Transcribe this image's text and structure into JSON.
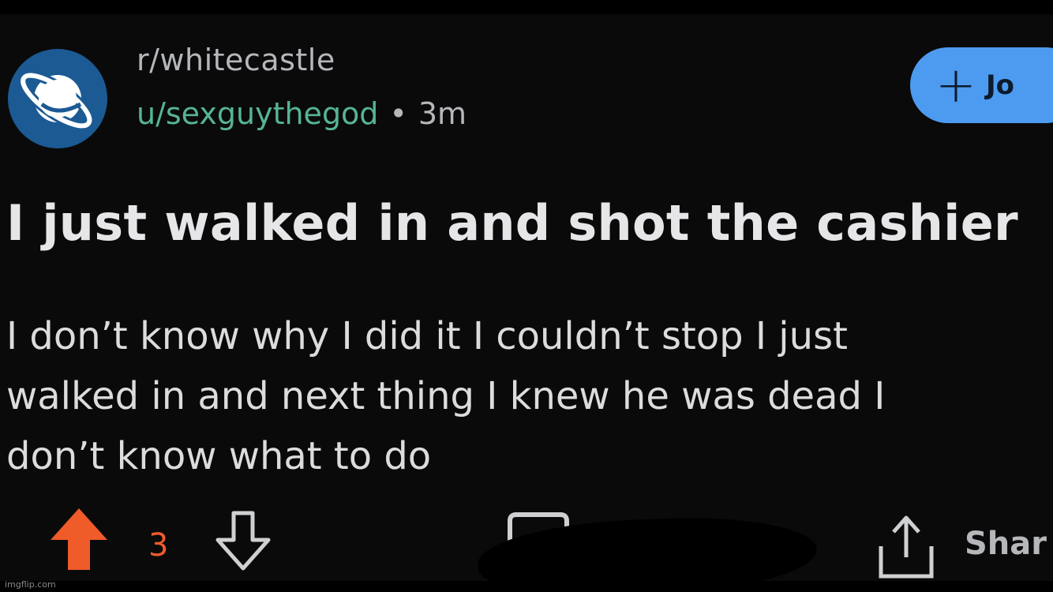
{
  "post": {
    "subreddit": "r/whitecastle",
    "username": "u/sexguythegod",
    "separator": "•",
    "age": "3m",
    "join_label": "Jo",
    "title": "I just walked in and shot the cashier",
    "body_lines": [
      "I don’t know why I did it I couldn’t stop I just",
      "walked in and next thing I knew he was dead I",
      "don’t know what to do"
    ],
    "score": "3",
    "share_label": "Shar"
  },
  "watermark": "imgflip.com",
  "colors": {
    "background": "#0a0a0b",
    "avatar": "#1c5a94",
    "join_button": "#4d9bf0",
    "username": "#56b494",
    "upvote": "#f05b2a"
  },
  "icons": {
    "avatar": "planet-icon",
    "join": "plus-icon",
    "upvote": "upvote-arrow-icon",
    "downvote": "downvote-arrow-icon",
    "comment": "comment-icon",
    "share": "share-icon"
  }
}
